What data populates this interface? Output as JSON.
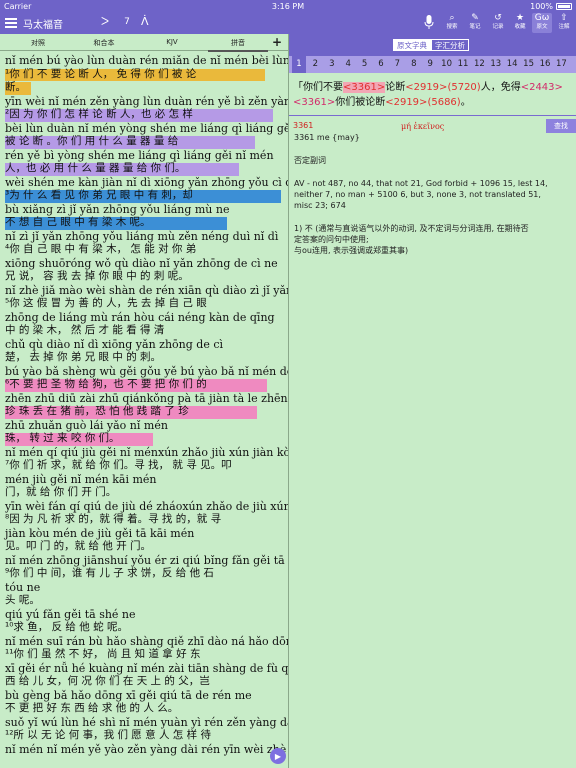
{
  "status": {
    "carrier": "Carrier",
    "time": "3:16 PM",
    "battery": "100%"
  },
  "nav": {
    "book": "马太福音",
    "chapter": "7",
    "tools": [
      {
        "icon": "⌕",
        "label": "搜索"
      },
      {
        "icon": "✎",
        "label": "笔记"
      },
      {
        "icon": "↺",
        "label": "记录"
      },
      {
        "icon": "★",
        "label": "收藏"
      },
      {
        "icon": "Gω",
        "label": "原文"
      },
      {
        "icon": "⇧",
        "label": "注解"
      }
    ]
  },
  "left": {
    "tabs": [
      "对照",
      "和合本",
      "KJV",
      "拼音"
    ],
    "lines": [
      {
        "kind": "pinyin",
        "text": " nǐ mén bú yào lùn duàn rén miǎn de nǐ mén bèi lùn"
      },
      {
        "kind": "hanzi",
        "text": "¹你 们 不 要 论 断 人， 免 得 你 们 被 论"
      },
      {
        "kind": "hanzi",
        "text": " 断。"
      },
      {
        "kind": "pinyin",
        "text": "yīn wèi nǐ mén zěn yàng lùn duàn rén  yě bì zěn yàng"
      },
      {
        "kind": "hanzi",
        "text": "²因 为 你 们 怎  样  论  断  人，也 必 怎  样"
      },
      {
        "kind": "pinyin",
        "text": "bèi lùn duàn  nǐ mén yòng shén me liáng qì liáng gěi"
      },
      {
        "kind": "hanzi",
        "text": " 被  论  断 。你  们  用  什  么 量 器 量 给"
      },
      {
        "kind": "pinyin",
        "text": "rén  yě bì yòng shén me liáng qì liáng gěi nǐ mén"
      },
      {
        "kind": "hanzi",
        "text": " 人，也 必 用  什  么 量 器 量 给 你 们。"
      },
      {
        "kind": "pinyin",
        "text": " wèi shén me kàn jiàn nǐ dì xiōng yǎn zhōng yǒu cì  què"
      },
      {
        "kind": "hanzi",
        "text": "³为  什 么 看 见 你 弟 兄  眼  中  有 刺，却"
      },
      {
        "kind": "pinyin",
        "text": "bù xiǎng zì jǐ yǎn zhōng yǒu liáng mù ne"
      },
      {
        "kind": "hanzi",
        "text": " 不  想  自 己 眼  中  有  梁  木 呢。"
      },
      {
        "kind": "pinyin",
        "text": " nǐ zì jǐ yǎn zhōng yǒu liáng mù  zěn néng duì nǐ dì"
      },
      {
        "kind": "hanzi",
        "text": "⁴你 自 己 眼  中  有  梁  木， 怎  能  对 你 弟"
      },
      {
        "kind": "pinyin",
        "text": "xiōng shuōróng wǒ qù diào nǐ yǎn zhōng de cì ne"
      },
      {
        "kind": "hanzi",
        "text": "  兄   说， 容  我 去 掉 你 眼  中  的 刺 呢。"
      },
      {
        "kind": "pinyin",
        "text": " nǐ zhè jiǎ mào wèi shàn de rén xiān qù diào zì jǐ yǎn"
      },
      {
        "kind": "hanzi",
        "text": "⁵你 这 假 冒 为  善 的 人，先 去 掉 自 己 眼"
      },
      {
        "kind": "pinyin",
        "text": "zhōng de liáng mù  rán hòu cái néng kàn de qīng"
      },
      {
        "kind": "hanzi",
        "text": "  中  的  梁  木， 然 后 才  能  看 得 清"
      },
      {
        "kind": "pinyin",
        "text": "chǔ  qù diào nǐ dì xiōng yǎn zhōng de cì"
      },
      {
        "kind": "hanzi",
        "text": " 楚， 去 掉 你 弟  兄  眼  中  的 刺。"
      },
      {
        "kind": "pinyin",
        "text": " bú yào bǎ shèng wù gěi gǒu  yě bú yào bǎ nǐ mén de"
      },
      {
        "kind": "hanzi",
        "text": "⁶不 要 把  圣  物 给 狗，也 不 要 把 你 们 的"
      },
      {
        "kind": "pinyin",
        "text": "zhēn zhū diū zài zhū qiánkǒng pà tā jiàn tà le zhēn"
      },
      {
        "kind": "hanzi",
        "text": " 珍  珠 丢 在 猪  前，恐  怕 他 践 踏 了 珍"
      },
      {
        "kind": "pinyin",
        "text": "zhū zhuǎn guò lái yǎo nǐ mén"
      },
      {
        "kind": "hanzi",
        "text": " 珠，  转  过  来  咬  你 们。"
      },
      {
        "kind": "pinyin",
        "text": " nǐ mén qí qiú  jiù gěi nǐ ménxún zhǎo  jiù xún jiàn kòu"
      },
      {
        "kind": "hanzi",
        "text": "⁷你 们 祈 求，就 给 你 们。寻  找， 就  寻  见。叩"
      },
      {
        "kind": "pinyin",
        "text": "mén jiù gěi nǐ mén kāi mén"
      },
      {
        "kind": "hanzi",
        "text": "  门，就 给 你 们 开  门。"
      },
      {
        "kind": "pinyin",
        "text": "yīn wèi fán qí qiú de   jiù dé zháoxún zhǎo de   jiù xún"
      },
      {
        "kind": "hanzi",
        "text": "⁸因  为 凡 祈 求 的，就 得 着。寻   找  的，就  寻"
      },
      {
        "kind": "pinyin",
        "text": "jiàn kòu mén de   jiù gěi tā kāi mén"
      },
      {
        "kind": "hanzi",
        "text": " 见。叩  门  的，就 给 他 开  门。"
      },
      {
        "kind": "pinyin",
        "text": " nǐ mén zhōng jiānshuí yǒu ér zi qiú bǐng fǎn gěi tā shí"
      },
      {
        "kind": "hanzi",
        "text": "⁹你  们   中    间，谁  有 儿 子 求  饼，反  给 他 石"
      },
      {
        "kind": "pinyin",
        "text": "tóu ne"
      },
      {
        "kind": "hanzi",
        "text": " 头 呢。"
      },
      {
        "kind": "pinyin",
        "text": " qiú yú   fǎn gěi tā shé ne"
      },
      {
        "kind": "hanzi",
        "text": "¹⁰求  鱼，  反  给 他 蛇 呢。"
      },
      {
        "kind": "pinyin",
        "text": " nǐ mén suī rán bù hǎo shàng qiě zhī dào ná hǎo dōng"
      },
      {
        "kind": "hanzi",
        "text": "¹¹你 们  虽  然  不 好，  尚    且  知  道  拿  好   东"
      },
      {
        "kind": "pinyin",
        "text": "xī gěi ér nǚ   hé kuàng nǐ mén zài tiān shàng de fù   qí"
      },
      {
        "kind": "hanzi",
        "text": " 西 给 儿 女，何   况   你 们 在  天    上   的 父，岂"
      },
      {
        "kind": "pinyin",
        "text": "bù gèng bǎ hǎo dōng xī gěi qiú tā de rén me"
      },
      {
        "kind": "hanzi",
        "text": " 不  更  把  好   东    西 给 求 他 的 人  么。"
      },
      {
        "kind": "pinyin",
        "text": " suǒ yǐ wú lùn hé shì   nǐ mén yuàn yì rén zěn yàng dài"
      },
      {
        "kind": "hanzi",
        "text": "¹²所 以 无 论 何  事，我 们  愿   意 人  怎   样   待"
      },
      {
        "kind": "pinyin",
        "text": "nǐ mén nǐ mén yě yào zěn yàng dài rén  yīn wèi zhè jiù"
      }
    ]
  },
  "right": {
    "seg_original": "原文字典",
    "seg_analysis": "字汇分析",
    "verse_numbers": [
      "1",
      "2",
      "3",
      "4",
      "5",
      "6",
      "7",
      "8",
      "9",
      "10",
      "11",
      "12",
      "13",
      "14",
      "15",
      "16",
      "17"
    ],
    "verse_text": {
      "a": "「你们不要",
      "b": "<3361>",
      "c": "论断",
      "d": "<2919>",
      "e": "(5720)",
      "f": "人，免得",
      "g": "<2443>",
      "h": "<3361>",
      "i": "你们被论断",
      "j": "<2919>",
      "k": "(5686)",
      "l": "。"
    },
    "strong_number": "3361",
    "strong_greek": "μή ἐκεῖνος",
    "search_label": "查找",
    "entry_1": "3361 me {may}",
    "entry_2": "否定副词",
    "entry_3": "AV - not 487, no 44, that not 21, God forbid + 1096 15, lest 14,\n    neither 7, no man + 5100 6, but 3, none 3, not translated 51,\n    misc 23; 674",
    "entry_4": "1) 不 (通常与直说语气以外的动词, 及不定词与分词连用, 在期待否\n    定答案的问句中使用;\n    与ou连用, 表示强调或郑重其事)"
  }
}
